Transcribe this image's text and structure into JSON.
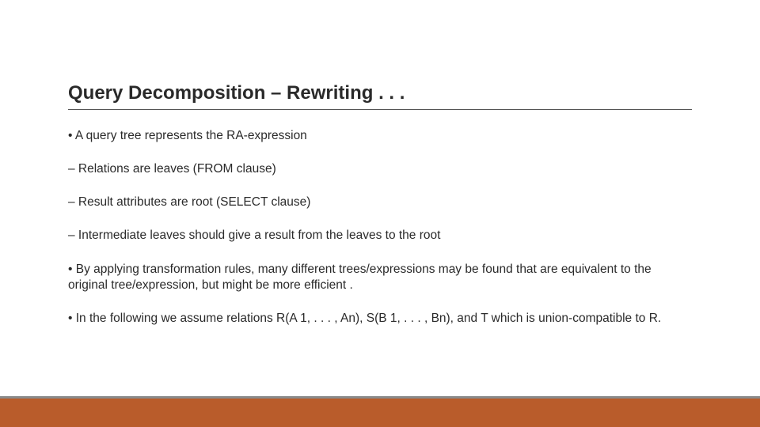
{
  "title": "Query Decomposition – Rewriting . . .",
  "bullets": {
    "b1": "• A query tree represents the RA-expression",
    "b2": "–  Relations are leaves (FROM clause)",
    "b3": "–  Result attributes are root (SELECT clause)",
    "b4": "– Intermediate leaves should give a result from the leaves to the root",
    "b5": "• By applying transformation rules, many different trees/expressions may be found that are equivalent to the original tree/expression, but might be more efficient .",
    "b6": "• In the following we assume relations R(A 1, . . . , An), S(B 1, . . . , Bn), and T which is union-compatible to R."
  }
}
